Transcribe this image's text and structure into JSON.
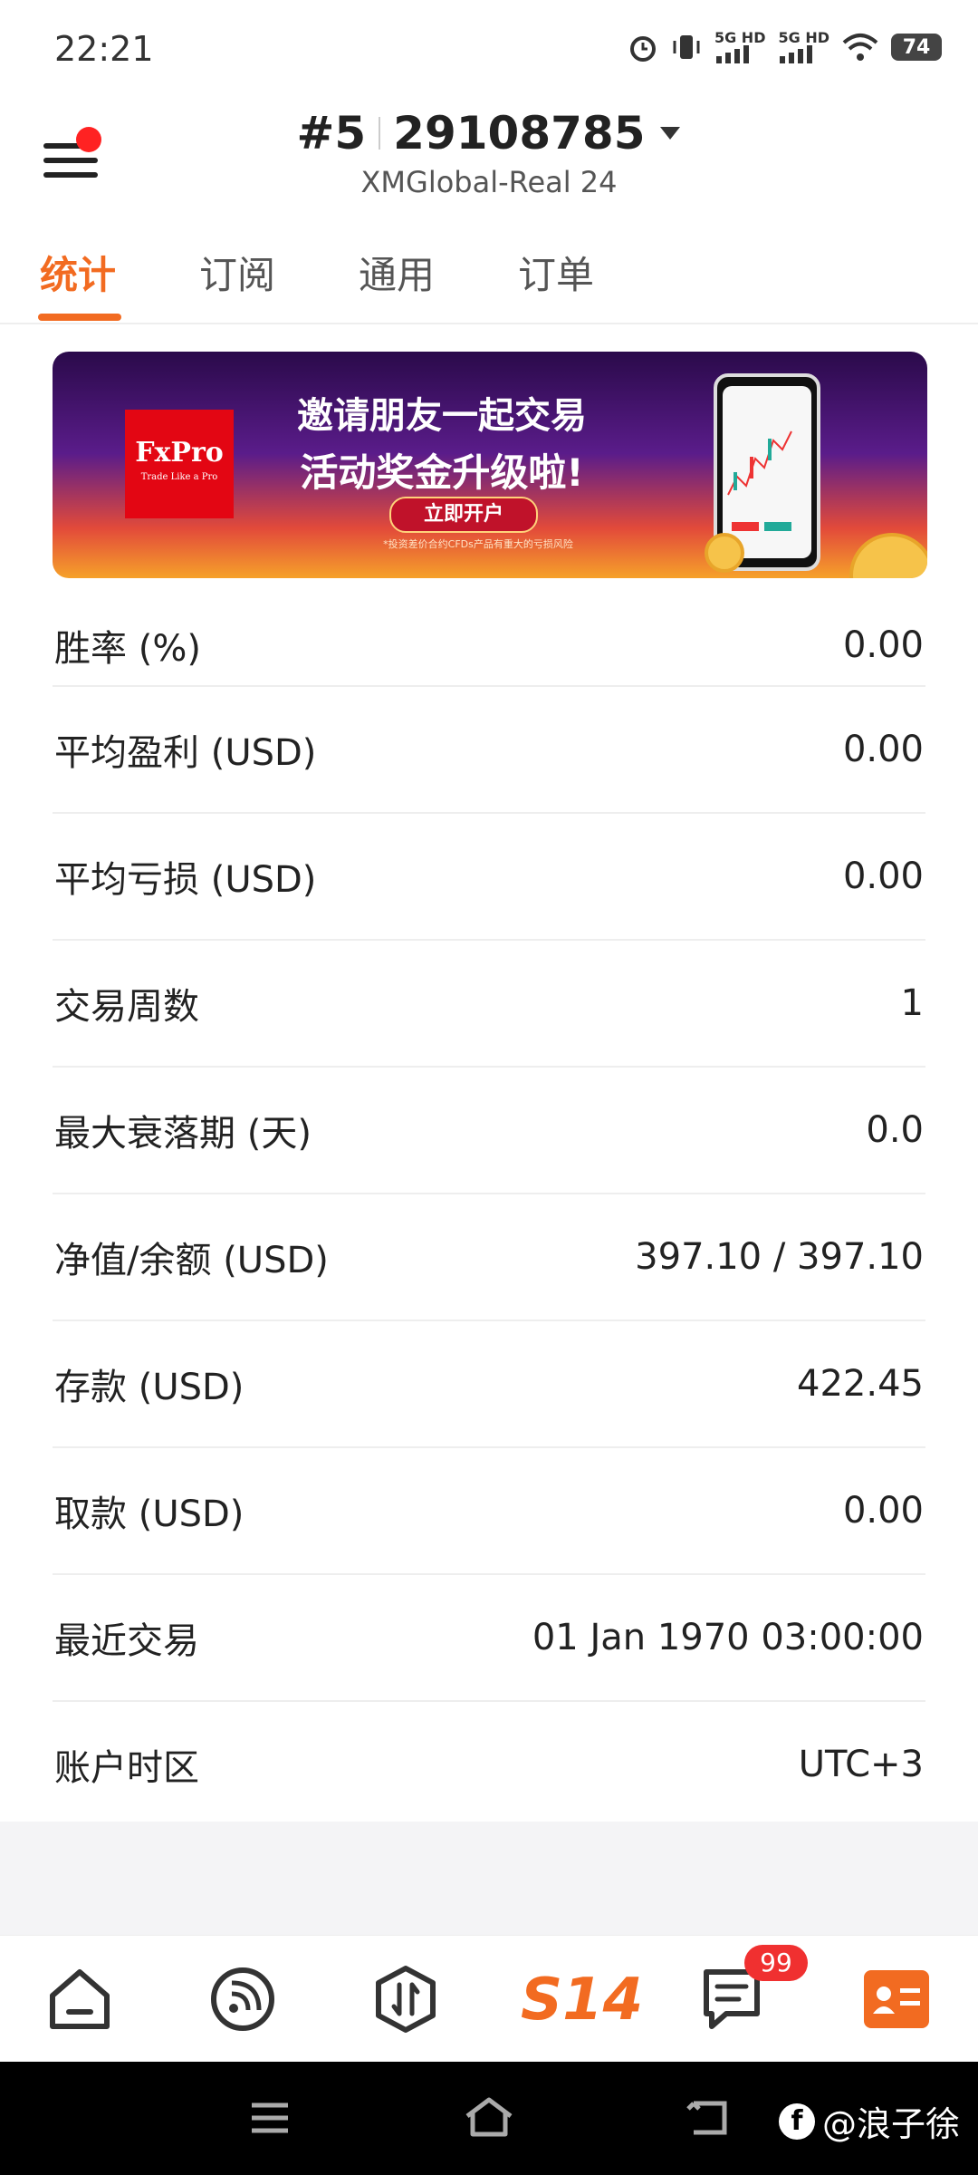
{
  "status_bar": {
    "time": "22:21",
    "net1": "5G HD",
    "net2": "5G HD",
    "battery": "74"
  },
  "header": {
    "account_prefix": "#5",
    "account_number": "29108785",
    "server": "XMGlobal-Real 24"
  },
  "tabs": [
    "统计",
    "订阅",
    "通用",
    "订单"
  ],
  "banner": {
    "brand": "FxPro",
    "brand_tagline": "Trade Like a Pro",
    "line1": "邀请朋友一起交易",
    "line2": "活动奖金升级啦!",
    "cta": "立即开户",
    "fineprint": "*投资差价合约CFDs产品有重大的亏损风险"
  },
  "stats": [
    {
      "label": "胜率 (%)",
      "value": "0.00"
    },
    {
      "label": "平均盈利 (USD)",
      "value": "0.00"
    },
    {
      "label": "平均亏损 (USD)",
      "value": "0.00"
    },
    {
      "label": "交易周数",
      "value": "1"
    },
    {
      "label": "最大衰落期 (天)",
      "value": "0.0"
    },
    {
      "label": "净值/余额 (USD)",
      "value": "397.10 / 397.10"
    },
    {
      "label": "存款 (USD)",
      "value": "422.45"
    },
    {
      "label": "取款 (USD)",
      "value": "0.00"
    },
    {
      "label": "最近交易",
      "value": "01 Jan 1970 03:00:00"
    },
    {
      "label": "账户时区",
      "value": "UTC+3"
    }
  ],
  "bottom_nav": {
    "center_label": "S14",
    "messages_badge": "99",
    "icons": [
      "home-icon",
      "signal-icon",
      "trade-icon",
      "s14-icon",
      "messages-icon",
      "profile-card-icon"
    ]
  },
  "watermark": "@浪子徐",
  "colors": {
    "accent": "#f26b21",
    "badge": "#f03030"
  }
}
